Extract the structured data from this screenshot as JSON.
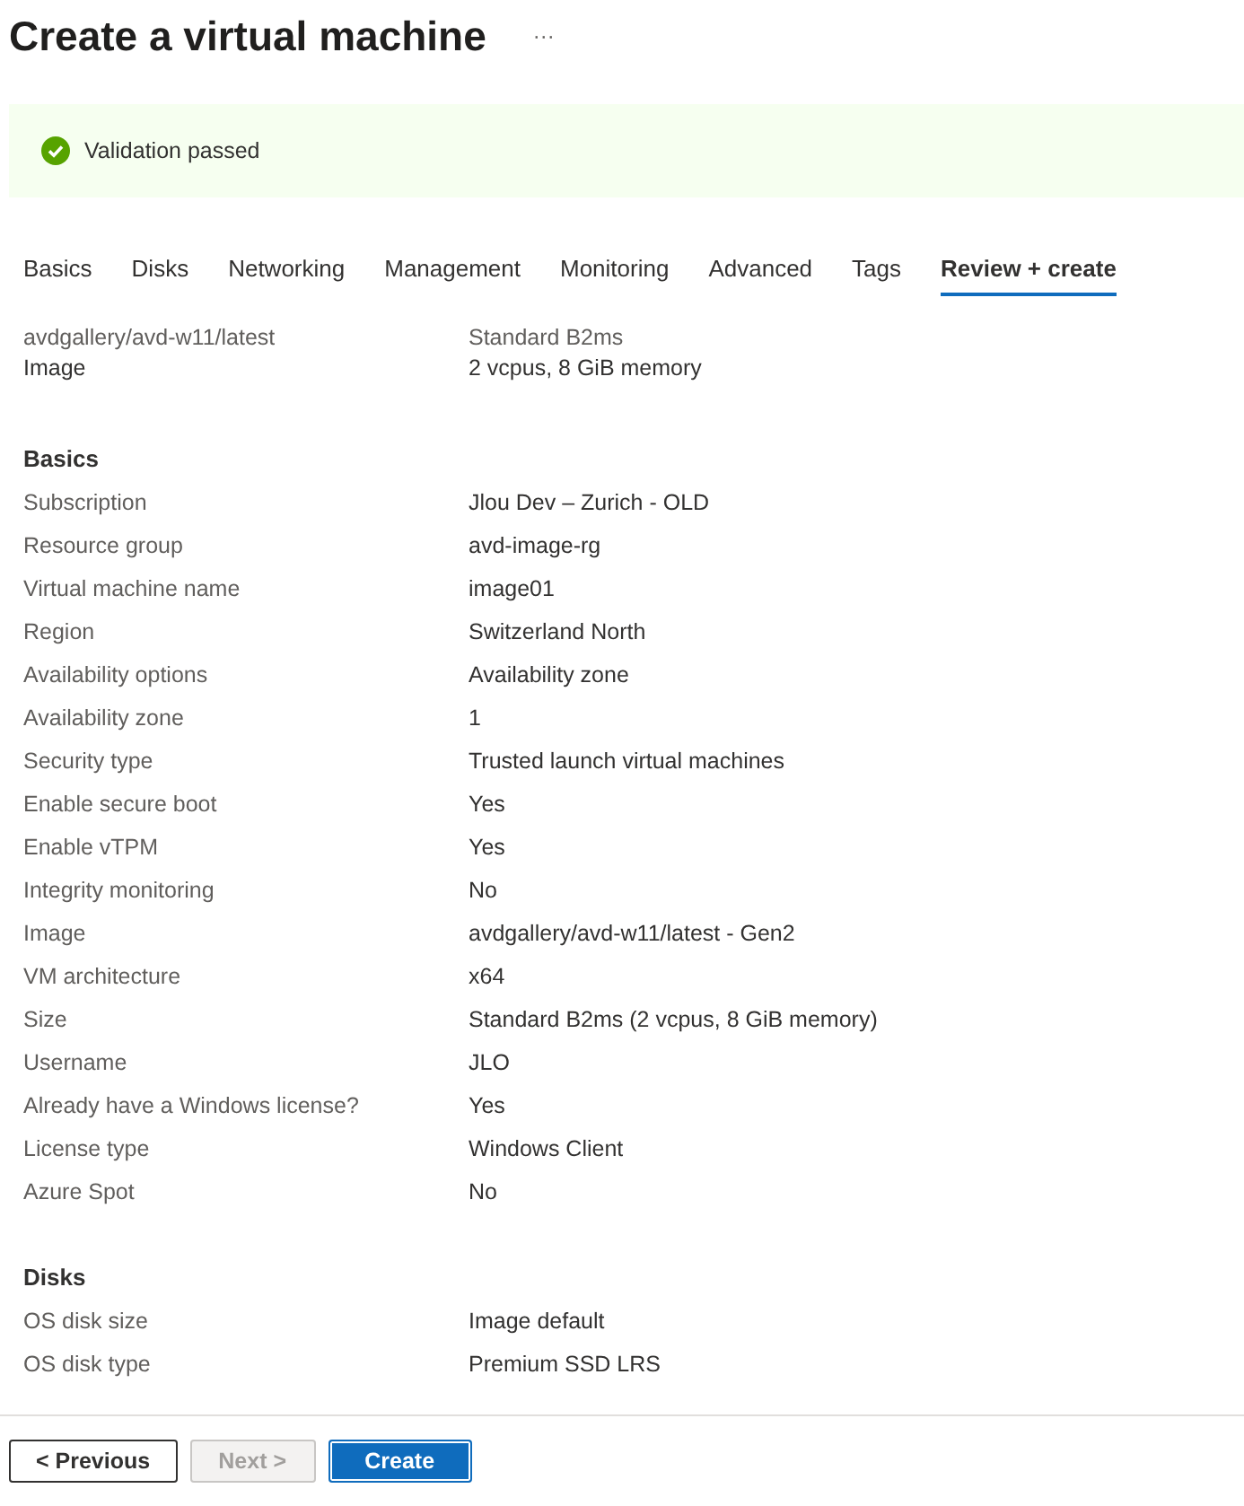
{
  "title": "Create a virtual machine",
  "more_button": "···",
  "banner": {
    "text": "Validation passed"
  },
  "tabs": [
    {
      "label": "Basics",
      "selected": false
    },
    {
      "label": "Disks",
      "selected": false
    },
    {
      "label": "Networking",
      "selected": false
    },
    {
      "label": "Management",
      "selected": false
    },
    {
      "label": "Monitoring",
      "selected": false
    },
    {
      "label": "Advanced",
      "selected": false
    },
    {
      "label": "Tags",
      "selected": false
    },
    {
      "label": "Review + create",
      "selected": true
    }
  ],
  "summary": [
    {
      "caption": "avdgallery/avd-w11/latest",
      "value": "Image"
    },
    {
      "caption": "Standard B2ms",
      "value": "2 vcpus, 8 GiB memory"
    }
  ],
  "sections": [
    {
      "heading": "Basics",
      "rows": [
        {
          "label": "Subscription",
          "value": "Jlou Dev – Zurich - OLD"
        },
        {
          "label": "Resource group",
          "value": "avd-image-rg"
        },
        {
          "label": "Virtual machine name",
          "value": "image01"
        },
        {
          "label": "Region",
          "value": "Switzerland North"
        },
        {
          "label": "Availability options",
          "value": "Availability zone"
        },
        {
          "label": "Availability zone",
          "value": "1"
        },
        {
          "label": "Security type",
          "value": "Trusted launch virtual machines"
        },
        {
          "label": "Enable secure boot",
          "value": "Yes"
        },
        {
          "label": "Enable vTPM",
          "value": "Yes"
        },
        {
          "label": "Integrity monitoring",
          "value": "No"
        },
        {
          "label": "Image",
          "value": "avdgallery/avd-w11/latest - Gen2"
        },
        {
          "label": "VM architecture",
          "value": "x64"
        },
        {
          "label": "Size",
          "value": "Standard B2ms (2 vcpus, 8 GiB memory)"
        },
        {
          "label": "Username",
          "value": "JLO"
        },
        {
          "label": "Already have a Windows license?",
          "value": "Yes"
        },
        {
          "label": "License type",
          "value": "Windows Client"
        },
        {
          "label": "Azure Spot",
          "value": "No"
        }
      ]
    },
    {
      "heading": "Disks",
      "rows": [
        {
          "label": "OS disk size",
          "value": "Image default"
        },
        {
          "label": "OS disk type",
          "value": "Premium SSD LRS"
        }
      ]
    }
  ],
  "footer": [
    {
      "label": "< Previous",
      "kind": "secondary",
      "disabled": false
    },
    {
      "label": "Next >",
      "kind": "secondary",
      "disabled": true
    },
    {
      "label": "Create",
      "kind": "primary",
      "disabled": false
    }
  ]
}
